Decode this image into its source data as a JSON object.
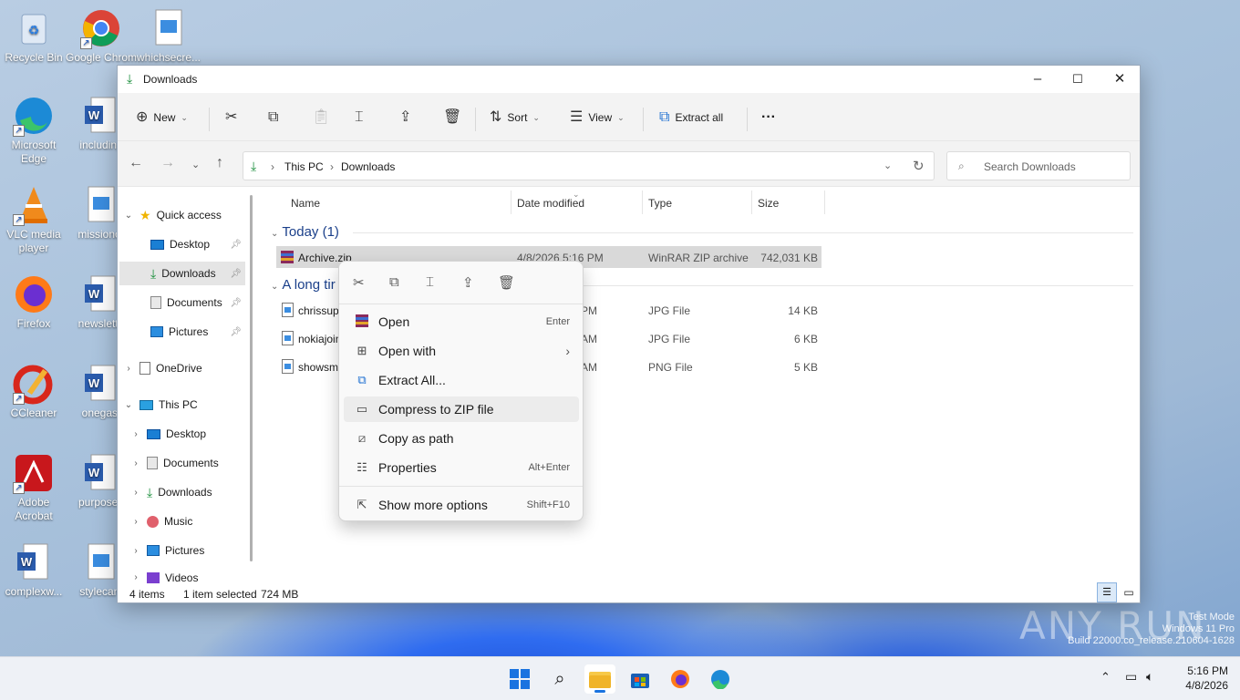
{
  "desktop": {
    "icons": [
      {
        "label": "Recycle Bin"
      },
      {
        "label": "Google Chrome"
      },
      {
        "label": "whichsecre..."
      },
      {
        "label": "Microsoft Edge"
      },
      {
        "label": "including"
      },
      {
        "label": "VLC media player"
      },
      {
        "label": "missionor"
      },
      {
        "label": "Firefox"
      },
      {
        "label": "newslette"
      },
      {
        "label": "CCleaner"
      },
      {
        "label": "onegas."
      },
      {
        "label": "Adobe Acrobat"
      },
      {
        "label": "purposen"
      },
      {
        "label": "complexw..."
      },
      {
        "label": "stylecam"
      }
    ],
    "watermark": {
      "line1": "Test Mode",
      "line2": "Windows 11 Pro",
      "line3": "Build 22000.co_release.210604-1628",
      "brand": "ANY RUN"
    }
  },
  "window": {
    "title": "Downloads",
    "controls": {
      "minimize": "–",
      "maximize": "☐",
      "close": "✕"
    },
    "toolbar": {
      "new_label": "New",
      "sort_label": "Sort",
      "view_label": "View",
      "extract_label": "Extract all",
      "more": "···"
    },
    "address": {
      "crumb1": "This PC",
      "crumb2": "Downloads",
      "search_placeholder": "Search Downloads"
    },
    "sidebar": {
      "quick_access": "Quick access",
      "qa_items": [
        {
          "label": "Desktop"
        },
        {
          "label": "Downloads"
        },
        {
          "label": "Documents"
        },
        {
          "label": "Pictures"
        }
      ],
      "onedrive": "OneDrive",
      "this_pc": "This PC",
      "pc_items": [
        {
          "label": "Desktop"
        },
        {
          "label": "Documents"
        },
        {
          "label": "Downloads"
        },
        {
          "label": "Music"
        },
        {
          "label": "Pictures"
        },
        {
          "label": "Videos"
        }
      ]
    },
    "columns": {
      "name": "Name",
      "date": "Date modified",
      "type": "Type",
      "size": "Size"
    },
    "groups": {
      "today": "Today (1)",
      "long_ago": "A long tir"
    },
    "files": [
      {
        "name": "Archive.zip",
        "date": "4/8/2026 5:16 PM",
        "type": "WinRAR ZIP archive",
        "size": "742,031 KB"
      },
      {
        "name": "chrissup",
        "date": "PM",
        "type": "JPG File",
        "size": "14 KB"
      },
      {
        "name": "nokiajoin",
        "date": "AM",
        "type": "JPG File",
        "size": "6 KB"
      },
      {
        "name": "showsm",
        "date": "AM",
        "type": "PNG File",
        "size": "5 KB"
      }
    ],
    "status": {
      "items": "4 items",
      "selected": "1 item selected",
      "size": "724 MB"
    }
  },
  "context_menu": {
    "items": [
      {
        "label": "Open",
        "key": "Enter"
      },
      {
        "label": "Open with",
        "key": "›"
      },
      {
        "label": "Extract All...",
        "key": ""
      },
      {
        "label": "Compress to ZIP file",
        "key": ""
      },
      {
        "label": "Copy as path",
        "key": ""
      },
      {
        "label": "Properties",
        "key": "Alt+Enter"
      },
      {
        "label": "Show more options",
        "key": "Shift+F10"
      }
    ]
  },
  "taskbar": {
    "time": "5:16 PM",
    "date": "4/8/2026"
  }
}
